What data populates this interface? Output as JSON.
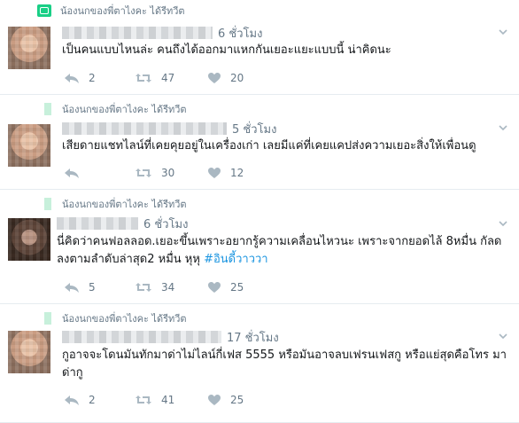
{
  "retweet_label": "น้องนกของพี่ตาไงคะ ได้รีทวีต",
  "tweets": [
    {
      "time": "6 ชั่วโมง",
      "text": "เป็นคนแบบไหนล่ะ คนถึงได้ออกมาแหกกันเยอะแยะแบบนี้ น่าคิดนะ",
      "hashtag": "",
      "replies": "2",
      "retweets": "47",
      "likes": "20"
    },
    {
      "time": "5 ชั่วโมง",
      "text": "เสียดายแชทไลน์ที่เคยคุยอยู่ในเครื่องเก่า เลยมีแค่ที่เคยแคปส่งความเยอะสิ่งให้เพื่อนดู",
      "hashtag": "",
      "replies": "",
      "retweets": "30",
      "likes": "12"
    },
    {
      "time": "6 ชั่วโมง",
      "text": "นี่คิดว่าคนฟอลลอด.เยอะขึ้นเพราะอยากรู้ความเคลื่อนไหวนะ เพราะจากยอดไล้ 8หมื่น กัลด ลงตามลำดับล่าสุด2 หมื่น หุหุ ",
      "hashtag": "#อินดี้วาววา",
      "replies": "5",
      "retweets": "34",
      "likes": "25"
    },
    {
      "time": "17 ชั่วโมง",
      "text": "กูอาจจะโดนมันทักมาด่าไม่ไลน์กี่เฟส 5555 หรือมันอาจลบเฟรนเฟสกู หรือแย่สุดคือโทร มาด่ากู",
      "hashtag": "",
      "replies": "2",
      "retweets": "41",
      "likes": "25"
    }
  ],
  "colors": {
    "retweet_green": "#19cf86",
    "meta_gray": "#657786",
    "hashtag_blue": "#1b95e0",
    "divider": "#e6ecf0"
  },
  "icons": [
    "retweet-icon",
    "reply-icon",
    "retweet-action-icon",
    "heart-icon",
    "chevron-down-icon"
  ]
}
